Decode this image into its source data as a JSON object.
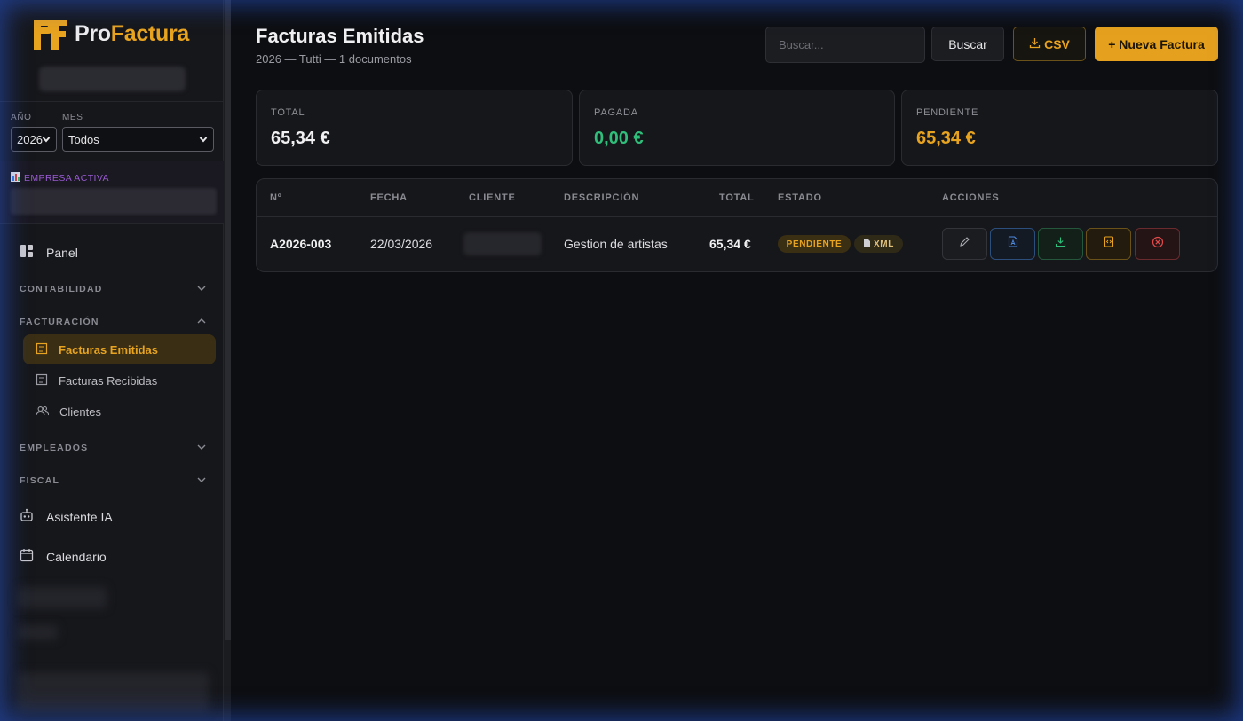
{
  "app": {
    "brand_prefix": "Pro",
    "brand_suffix": "Factura",
    "logo_mark": "PF"
  },
  "sidebar": {
    "filters": {
      "year_label": "AÑO",
      "year_value": "2026",
      "month_label": "MES",
      "month_value": "Todos"
    },
    "empresa_label": "EMPRESA ACTIVA",
    "nav": {
      "panel": "Panel",
      "contabilidad": "CONTABILIDAD",
      "facturacion": "FACTURACIÓN",
      "emitidas": "Facturas Emitidas",
      "recibidas": "Facturas Recibidas",
      "clientes": "Clientes",
      "empleados": "EMPLEADOS",
      "fiscal": "FISCAL",
      "asistente": "Asistente IA",
      "calendario": "Calendario"
    }
  },
  "header": {
    "title": "Facturas Emitidas",
    "subtitle": "2026 — Tutti — 1 documentos",
    "search_placeholder": "Buscar...",
    "search_button": "Buscar",
    "csv_button": "CSV",
    "new_button": "+ Nueva Factura"
  },
  "summary": {
    "total_label": "TOTAL",
    "total_value": "65,34 €",
    "pagada_label": "PAGADA",
    "pagada_value": "0,00 €",
    "pendiente_label": "PENDIENTE",
    "pendiente_value": "65,34 €"
  },
  "table": {
    "headers": {
      "num": "Nº",
      "fecha": "FECHA",
      "cliente": "CLIENTE",
      "descripcion": "DESCRIPCIÓN",
      "total": "TOTAL",
      "estado": "ESTADO",
      "acciones": "ACCIONES"
    },
    "rows": [
      {
        "num": "A2026-003",
        "fecha": "22/03/2026",
        "descripcion": "Gestion de artistas",
        "total": "65,34 €",
        "estado": "PENDIENTE",
        "xml_badge": "XML"
      }
    ]
  },
  "colors": {
    "accent": "#e5a11d",
    "paid": "#2fbf7a",
    "pending": "#e8a31f",
    "empresa": "#9a5bd4"
  },
  "icons": {
    "edit": "pencil-icon",
    "pdf": "pdf-icon",
    "download": "download-icon",
    "xml": "code-file-icon",
    "cancel": "cancel-icon"
  }
}
